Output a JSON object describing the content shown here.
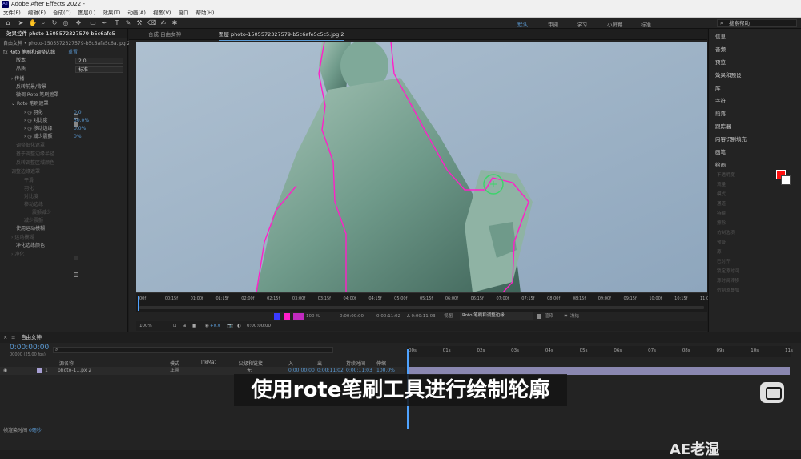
{
  "app": {
    "title": "Adobe After Effects 2022 -"
  },
  "menu": [
    "文件(F)",
    "编辑(E)",
    "合成(C)",
    "图层(L)",
    "效果(T)",
    "动画(A)",
    "视图(V)",
    "窗口",
    "帮助(H)"
  ],
  "workspaces": {
    "default": "默认",
    "review": "审阅",
    "learn": "学习",
    "small_screen": "小屏幕",
    "standard": "标准"
  },
  "search_help": "搜索帮助",
  "effect_controls": {
    "tab": "效果控件 photo-1505572327579-b5c6afe5",
    "layer_path": "自由女神 • photo-1505572327579-b5c6afa5c6a.jpg 2",
    "effect_name": "Roto 笔刷和调整边缘",
    "reset": "重置",
    "version_label": "版本",
    "version_value": "2.0",
    "quality_label": "品质",
    "quality_value": "标准",
    "propagation": "传播",
    "invert_fg_bg": "反转前景/背景",
    "fine_tune_roto": "微调 Roto 笔刷遮罩",
    "roto_matte": "Roto 笔刷遮罩",
    "feather_label": "羽化",
    "feather_value": "0.0",
    "contrast_label": "对比度",
    "contrast_value": "30.0%",
    "shift_edge_label": "移动边缘",
    "shift_edge_value": "0.0%",
    "reduce_chatter_label": "减少震颤",
    "reduce_chatter_value": "0%",
    "dim_rows": [
      "调整细化遮罩",
      "基于调整边缘半径",
      "反转调整区域颜色",
      "调整边缘遮罩",
      "平滑",
      "羽化",
      "对比度",
      "移动边缘",
      "震颤减少",
      "减少震颤"
    ],
    "use_motion_blur": "使用运动模糊",
    "motion_blur": "运动模糊",
    "decontaminate": "净化边缘颜色",
    "purify": "净化"
  },
  "viewer": {
    "comp_tab": "合成 自由女神",
    "layer_tab": "图层 photo-1505572327579-b5c6afe5c5c5.jpg 2",
    "time_ticks": [
      "00f",
      "00:15f",
      "01:00f",
      "01:15f",
      "02:00f",
      "02:15f",
      "03:00f",
      "03:15f",
      "04:00f",
      "04:15f",
      "05:00f",
      "05:15f",
      "06:00f",
      "06:15f",
      "07:00f",
      "07:15f",
      "08:00f",
      "08:15f",
      "09:00f",
      "09:15f",
      "10:00f",
      "10:15f",
      "11:00"
    ],
    "zoom": "100%",
    "time_in": "0:00:00:00",
    "time_cur": "0:00:11:02",
    "time_dur": "Δ 0:00:11:03",
    "view_label": "视图",
    "view_value": "Roto 笔刷和调整边缘",
    "render_label": "渲染",
    "freeze_label": "冻结",
    "exposure": "+0.0",
    "timecode": "0:00:00:00",
    "opacity": "100 %"
  },
  "right_panel": {
    "items": [
      "信息",
      "音频",
      "预览",
      "效果和预设",
      "库",
      "字符",
      "段落",
      "跟踪器",
      "内容识别填充",
      "画笔",
      "绘画"
    ],
    "paint_props": [
      "不透明度",
      "流量",
      "模式",
      "通道",
      "持续",
      "擦除",
      "仿制选项",
      "预设",
      "源",
      "已对齐",
      "锁定源时间",
      "源时间转移",
      "仿制源叠加"
    ]
  },
  "timeline": {
    "comp_name": "自由女神",
    "timecode": "0:00:00:00",
    "frames": "00000 (25.00 fps)",
    "search_placeholder": "",
    "cols": {
      "name": "源名称",
      "mode": "模式",
      "trkmat": "TrkMat",
      "parent": "父级和链接",
      "in": "入",
      "out": "出",
      "duration": "持续时间",
      "stretch": "伸缩"
    },
    "layer": {
      "num": "1",
      "name": "photo-1...px 2",
      "mode": "正常",
      "parent": "无",
      "in": "0:00:00:00",
      "out": "0:00:11:02",
      "duration": "0:00:11:03",
      "stretch": "100.0%"
    },
    "ruler_ticks": [
      "00s",
      "01s",
      "02s",
      "03s",
      "04s",
      "05s",
      "06s",
      "07s",
      "08s",
      "09s",
      "10s",
      "11s"
    ],
    "render_time_label": "帧渲染时间",
    "render_time_value": "0毫秒"
  },
  "subtitle": "使用rote笔刷工具进行绘制轮廓",
  "watermark": "AE老湿"
}
